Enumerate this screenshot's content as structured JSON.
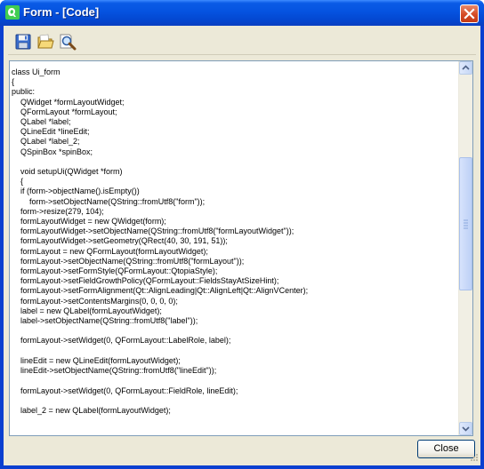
{
  "window": {
    "title": "Form - [Code]"
  },
  "toolbar": {
    "buttons": [
      "save-icon",
      "open-folder-icon",
      "find-icon"
    ]
  },
  "code_lines": [
    "class Ui_form",
    "{",
    "public:",
    "    QWidget *formLayoutWidget;",
    "    QFormLayout *formLayout;",
    "    QLabel *label;",
    "    QLineEdit *lineEdit;",
    "    QLabel *label_2;",
    "    QSpinBox *spinBox;",
    "",
    "    void setupUi(QWidget *form)",
    "    {",
    "    if (form->objectName().isEmpty())",
    "        form->setObjectName(QString::fromUtf8(\"form\"));",
    "    form->resize(279, 104);",
    "    formLayoutWidget = new QWidget(form);",
    "    formLayoutWidget->setObjectName(QString::fromUtf8(\"formLayoutWidget\"));",
    "    formLayoutWidget->setGeometry(QRect(40, 30, 191, 51));",
    "    formLayout = new QFormLayout(formLayoutWidget);",
    "    formLayout->setObjectName(QString::fromUtf8(\"formLayout\"));",
    "    formLayout->setFormStyle(QFormLayout::QtopiaStyle);",
    "    formLayout->setFieldGrowthPolicy(QFormLayout::FieldsStayAtSizeHint);",
    "    formLayout->setFormAlignment(Qt::AlignLeading|Qt::AlignLeft|Qt::AlignVCenter);",
    "    formLayout->setContentsMargins(0, 0, 0, 0);",
    "    label = new QLabel(formLayoutWidget);",
    "    label->setObjectName(QString::fromUtf8(\"label\"));",
    "",
    "    formLayout->setWidget(0, QFormLayout::LabelRole, label);",
    "",
    "    lineEdit = new QLineEdit(formLayoutWidget);",
    "    lineEdit->setObjectName(QString::fromUtf8(\"lineEdit\"));",
    "",
    "    formLayout->setWidget(0, QFormLayout::FieldRole, lineEdit);",
    "",
    "    label_2 = new QLabel(formLayoutWidget);"
  ],
  "buttons": {
    "close": "Close"
  },
  "scroll": {
    "position": 0.0
  },
  "colors": {
    "titlebar": "#0553e0",
    "client": "#ece9d8",
    "close_red": "#d54a25"
  }
}
